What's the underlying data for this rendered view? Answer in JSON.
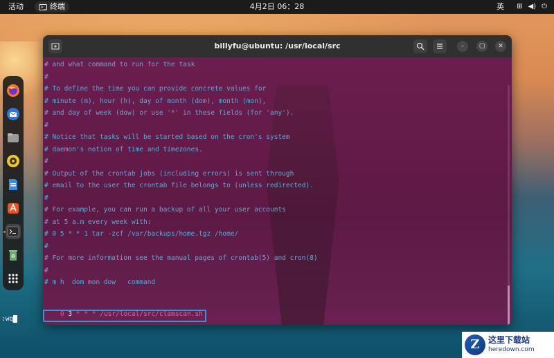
{
  "topbar": {
    "activities": "活动",
    "app_name": "终端",
    "clock": "4月2日  06：28",
    "ime": "英",
    "network_icon": "network-icon",
    "volume_icon": "volume-icon",
    "power_icon": "power-icon"
  },
  "dock": {
    "items": [
      {
        "name": "firefox",
        "icon": "firefox-icon"
      },
      {
        "name": "thunderbird",
        "icon": "mail-icon"
      },
      {
        "name": "files",
        "icon": "folder-icon"
      },
      {
        "name": "rhythmbox",
        "icon": "music-icon"
      },
      {
        "name": "writer",
        "icon": "document-icon"
      },
      {
        "name": "software",
        "icon": "store-icon"
      },
      {
        "name": "terminal",
        "icon": "terminal-icon"
      },
      {
        "name": "trash",
        "icon": "trash-icon"
      },
      {
        "name": "apps",
        "icon": "grid-icon"
      }
    ]
  },
  "terminal": {
    "title": "billyfu@ubuntu: /usr/local/src",
    "lines": [
      "# and what command to run for the task",
      "#",
      "# To define the time you can provide concrete values for",
      "# minute (m), hour (h), day of month (dom), month (mon),",
      "# and day of week (dow) or use '*' in these fields (for 'any').",
      "#",
      "# Notice that tasks will be started based on the cron's system",
      "# daemon's notion of time and timezones.",
      "#",
      "# Output of the crontab jobs (including errors) is sent through",
      "# email to the user the crontab file belongs to (unless redirected).",
      "#",
      "# For example, you can run a backup of all your user accounts",
      "# at 5 a.m every week with:",
      "# 0 5 * * 1 tar -zcf /var/backups/home.tgz /home/",
      "#",
      "# For more information see the manual pages of crontab(5) and cron(8)",
      "#",
      "# m h  dom mon dow   command",
      ""
    ],
    "cmd": {
      "min": "0",
      "hour": "3",
      "stars": "* * *",
      "path": "/usr/local/src/clamscan.sh"
    },
    "command_line": ":wq"
  },
  "watermark": {
    "logo": "Z",
    "main": "这里下载站",
    "sub": "heredown.com"
  }
}
